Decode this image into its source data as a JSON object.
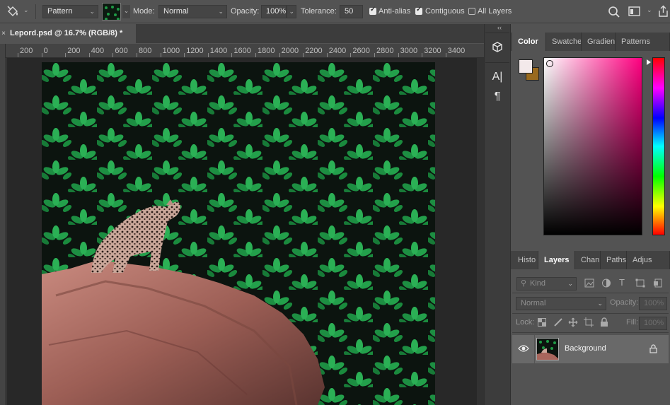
{
  "options_bar": {
    "tool_icon": "paint-bucket-icon",
    "fill_source": "Pattern",
    "mode_label": "Mode:",
    "mode_value": "Normal",
    "opacity_label": "Opacity:",
    "opacity_value": "100%",
    "tolerance_label": "Tolerance:",
    "tolerance_value": "50",
    "anti_alias_label": "Anti-alias",
    "anti_alias_checked": true,
    "contiguous_label": "Contiguous",
    "contiguous_checked": true,
    "all_layers_label": "All Layers",
    "all_layers_checked": false
  },
  "document": {
    "tab_title": "Lepord.psd @ 16.7% (RGB/8) *",
    "close_glyph": "×"
  },
  "ruler": {
    "labels": [
      "200",
      "0",
      "200",
      "400",
      "600",
      "800",
      "1000",
      "1200",
      "1400",
      "1600",
      "1800",
      "2000",
      "2200",
      "2400",
      "2600",
      "2800",
      "3000",
      "3200",
      "3400"
    ]
  },
  "side_strip": {
    "collapse_glyph": "‹‹",
    "buttons": [
      "3d-cube-icon",
      "character-icon",
      "paragraph-icon"
    ],
    "character_glyph": "A|",
    "paragraph_glyph": "¶"
  },
  "color_panel": {
    "tabs": [
      "Color",
      "Swatche",
      "Gradien",
      "Patterns"
    ],
    "active_tab": "Color",
    "foreground_color": "#f3e9ea",
    "background_color": "#9a6a1e"
  },
  "layers_panel": {
    "tabs": [
      "Histo",
      "Layers",
      "Chan",
      "Paths",
      "Adjus"
    ],
    "active_tab": "Layers",
    "filter_label": "Kind",
    "blend_mode": "Normal",
    "opacity_label": "Opacity:",
    "opacity_value": "100%",
    "lock_label": "Lock:",
    "fill_label": "Fill:",
    "fill_value": "100%",
    "layers": [
      {
        "name": "Background",
        "visible": true,
        "locked": true
      }
    ]
  }
}
